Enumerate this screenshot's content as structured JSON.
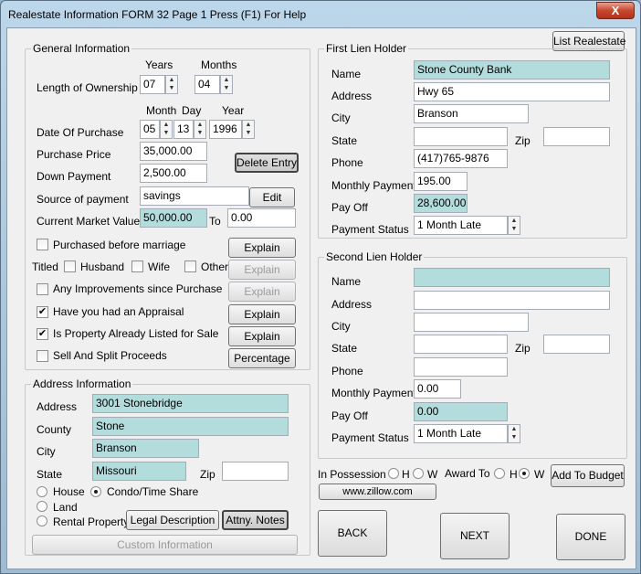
{
  "window": {
    "title": "Realestate Information   FORM 32    Page 1    Press (F1) For Help",
    "close_glyph": "X"
  },
  "list_realestate_label": "List Realestate",
  "general": {
    "group_label": "General Information",
    "years_header": "Years",
    "months_header": "Months",
    "length_label": "Length of Ownership",
    "years_value": "07",
    "months_value": "04",
    "month_header": "Month",
    "day_header": "Day",
    "year_header": "Year",
    "purchase_date_label": "Date Of Purchase",
    "purchase_month": "05",
    "purchase_day": "13",
    "purchase_year": "1996",
    "purchase_price_label": "Purchase Price",
    "purchase_price": "35,000.00",
    "down_payment_label": "Down Payment",
    "down_payment": "2,500.00",
    "delete_entry_label": "Delete Entry",
    "source_label": "Source of payment",
    "source_value": "savings",
    "edit_label": "Edit",
    "market_value_label": "Current Market Value",
    "market_value": "50,000.00",
    "to_label": "To",
    "market_value_to": "0.00",
    "purchased_before_marriage": "Purchased before marriage",
    "titled_label": "Titled",
    "husband": "Husband",
    "wife": "Wife",
    "other": "Other",
    "improvements": "Any Improvements since Purchase",
    "appraisal": "Have you had an Appraisal",
    "listed_for_sale": "Is Property Already Listed for Sale",
    "sell_split": "Sell And Split Proceeds",
    "explain_label": "Explain",
    "percentage_label": "Percentage",
    "check_glyph": "✔"
  },
  "address": {
    "group_label": "Address Information",
    "address_label": "Address",
    "address_value": "3001 Stonebridge",
    "county_label": "County",
    "county_value": "Stone",
    "city_label": "City",
    "city_value": "Branson",
    "state_label": "State",
    "state_value": "Missouri",
    "zip_label": "Zip",
    "zip_value": "",
    "house": "House",
    "condo": "Condo/Time Share",
    "land": "Land",
    "rental": "Rental Property",
    "legal_description": "Legal Description",
    "attny_notes": "Attny. Notes",
    "custom_information": "Custom Information"
  },
  "first_lien": {
    "group_label": "First Lien Holder",
    "name_label": "Name",
    "name_value": "Stone County Bank",
    "address_label": "Address",
    "address_value": "Hwy 65",
    "city_label": "City",
    "city_value": "Branson",
    "state_label": "State",
    "state_value": "",
    "zip_label": "Zip",
    "zip_value": "",
    "phone_label": "Phone",
    "phone_value": "(417)765-9876",
    "monthly_label": "Monthly Payment",
    "monthly_value": "195.00",
    "payoff_label": "Pay Off",
    "payoff_value": "28,600.00",
    "status_label": "Payment Status",
    "status_value": "1 Month Late"
  },
  "second_lien": {
    "group_label": "Second Lien Holder",
    "name_label": "Name",
    "name_value": "",
    "address_label": "Address",
    "address_value": "",
    "city_label": "City",
    "city_value": "",
    "state_label": "State",
    "state_value": "",
    "zip_label": "Zip",
    "zip_value": "",
    "phone_label": "Phone",
    "phone_value": "",
    "monthly_label": "Monthly Payment",
    "monthly_value": "0.00",
    "payoff_label": "Pay Off",
    "payoff_value": "0.00",
    "status_label": "Payment Status",
    "status_value": "1 Month Late"
  },
  "possession": {
    "label": "In Possession",
    "h": "H",
    "w": "W",
    "award_to": "Award To",
    "add_to_budget": "Add To Budget",
    "zillow": "www.zillow.com"
  },
  "nav": {
    "back": "BACK",
    "next": "NEXT",
    "done": "DONE"
  },
  "spin_up": "▲",
  "spin_down": "▼"
}
